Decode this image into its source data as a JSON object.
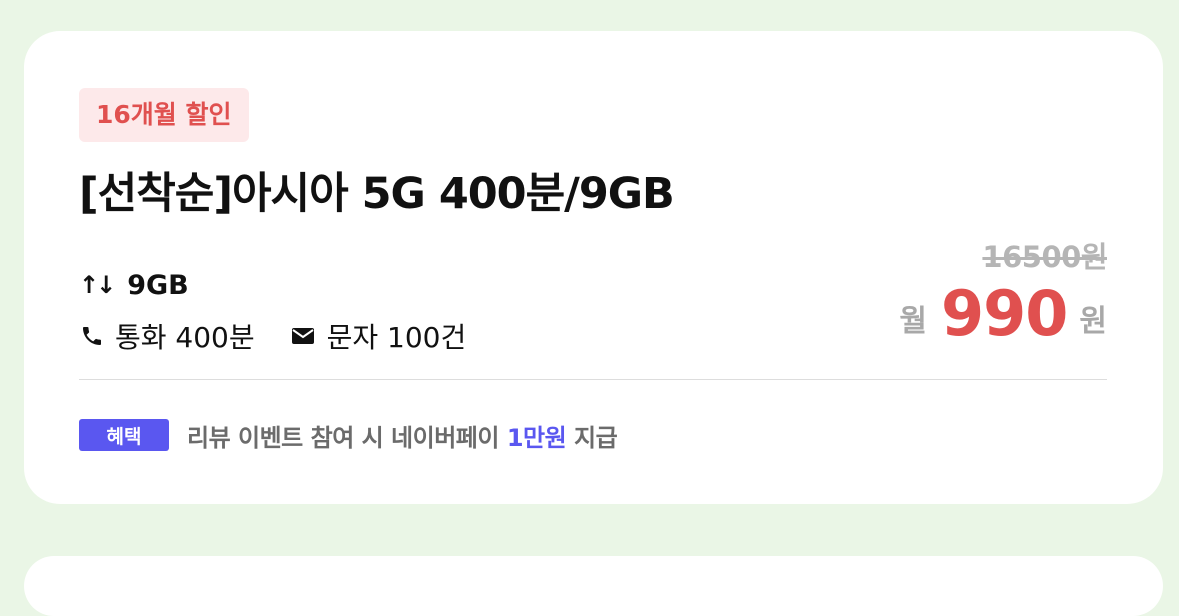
{
  "plan": {
    "badge": "16개월 할인",
    "title": "[선착순]아시아 5G 400분/9GB",
    "data": {
      "icon": "arrows-up-down-icon",
      "glyph": "↑↓",
      "value": "9GB"
    },
    "call": {
      "icon": "phone-icon",
      "label": "통화 400분"
    },
    "sms": {
      "icon": "mail-icon",
      "label": "문자 100건"
    },
    "price": {
      "original": "16500원",
      "prefix": "월",
      "amount": "990",
      "unit": "원"
    },
    "benefit": {
      "tag": "혜택",
      "text_before": "리뷰 이벤트 참여 시 네이버페이 ",
      "highlight": "1만원",
      "text_after": " 지급"
    }
  },
  "colors": {
    "background": "#eaf6e6",
    "card": "#ffffff",
    "badge_bg": "#fde9ea",
    "accent_red": "#e0504f",
    "benefit_blue": "#5a57f0",
    "muted_gray": "#a8a8a8"
  }
}
